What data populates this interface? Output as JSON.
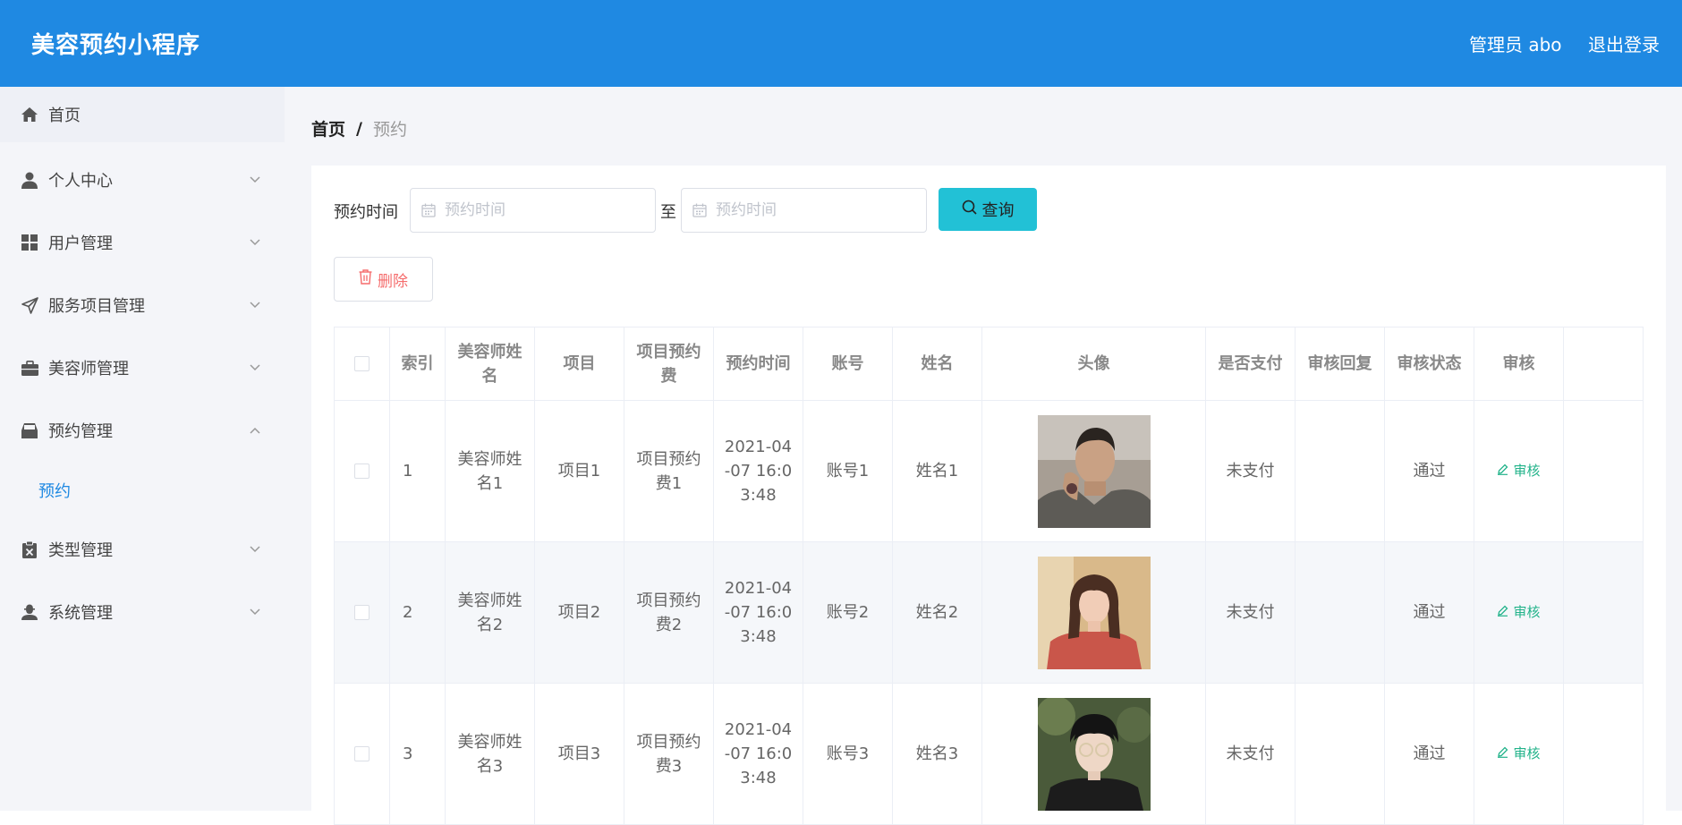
{
  "header": {
    "app_title": "美容预约小程序",
    "admin_label": "管理员 abo",
    "logout_label": "退出登录",
    "bar_color": "#1f89e2"
  },
  "sidebar": {
    "items": [
      {
        "label": "首页",
        "icon": "home-icon"
      },
      {
        "label": "个人中心",
        "icon": "user-icon"
      },
      {
        "label": "用户管理",
        "icon": "grid-icon"
      },
      {
        "label": "服务项目管理",
        "icon": "send-icon"
      },
      {
        "label": "美容师管理",
        "icon": "briefcase-icon"
      },
      {
        "label": "预约管理",
        "icon": "inbox-icon",
        "expanded": true
      },
      {
        "label": "类型管理",
        "icon": "clipboard-icon"
      },
      {
        "label": "系统管理",
        "icon": "admin-icon"
      }
    ],
    "sub_item": "预约"
  },
  "breadcrumb": {
    "home": "首页",
    "separator": "/",
    "current": "预约"
  },
  "search": {
    "label": "预约时间",
    "start_placeholder": "预约时间",
    "to_label": "至",
    "end_placeholder": "预约时间",
    "query_label": "查询"
  },
  "actions": {
    "delete_label": "删除"
  },
  "table": {
    "headers": [
      "索引",
      "美容师姓名",
      "项目",
      "项目预约费",
      "预约时间",
      "账号",
      "姓名",
      "头像",
      "是否支付",
      "审核回复",
      "审核状态",
      "审核"
    ],
    "rows": [
      {
        "index": "1",
        "beautician": "美容师姓名1",
        "project": "项目1",
        "fee": "项目预约费1",
        "time": "2021-04-07 16:03:48",
        "account": "账号1",
        "name": "姓名1",
        "paid": "未支付",
        "reply": "",
        "status": "通过",
        "audit": "审核"
      },
      {
        "index": "2",
        "beautician": "美容师姓名2",
        "project": "项目2",
        "fee": "项目预约费2",
        "time": "2021-04-07 16:03:48",
        "account": "账号2",
        "name": "姓名2",
        "paid": "未支付",
        "reply": "",
        "status": "通过",
        "audit": "审核"
      },
      {
        "index": "3",
        "beautician": "美容师姓名3",
        "project": "项目3",
        "fee": "项目预约费3",
        "time": "2021-04-07 16:03:48",
        "account": "账号3",
        "name": "姓名3",
        "paid": "未支付",
        "reply": "",
        "status": "通过",
        "audit": "审核"
      }
    ]
  }
}
